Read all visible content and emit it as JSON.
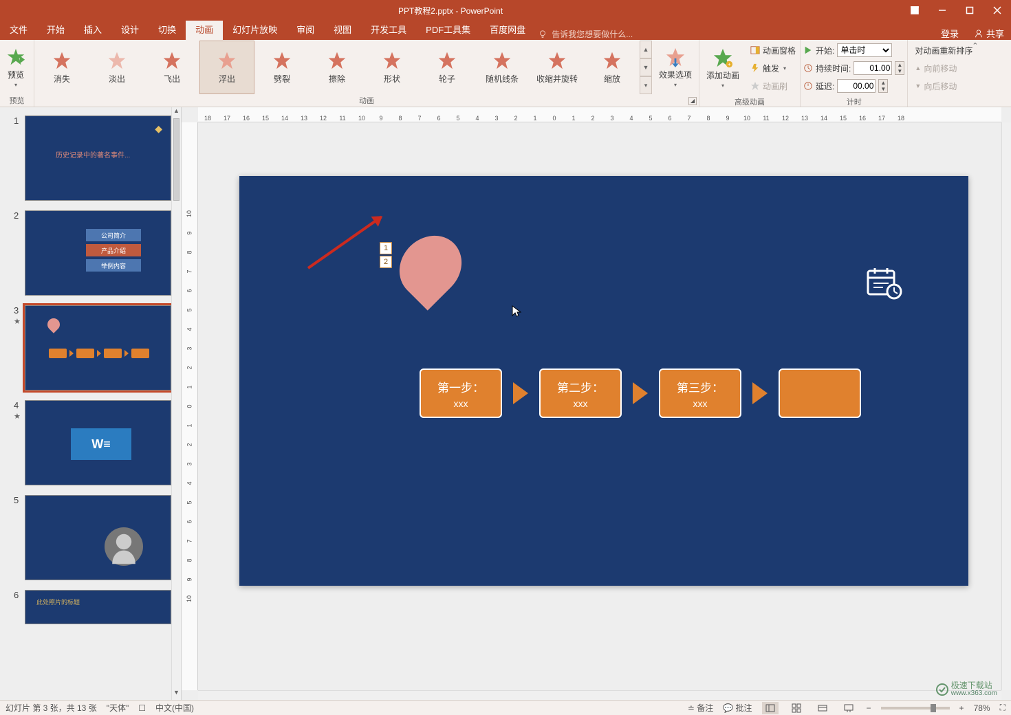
{
  "title": "PPT教程2.pptx - PowerPoint",
  "tabs": {
    "file": "文件",
    "home": "开始",
    "insert": "插入",
    "design": "设计",
    "transitions": "切换",
    "animations": "动画",
    "slideshow": "幻灯片放映",
    "review": "审阅",
    "view": "视图",
    "developer": "开发工具",
    "pdf": "PDF工具集",
    "baidu": "百度网盘",
    "tellme": "告诉我您想要做什么...",
    "signin": "登录",
    "share": "共享"
  },
  "ribbon": {
    "preview": "预览",
    "preview_group": "预览",
    "anim_group": "动画",
    "anim": {
      "disappear": "消失",
      "fade": "淡出",
      "flyout": "飞出",
      "floatout": "浮出",
      "split": "劈裂",
      "wipe": "擦除",
      "shape": "形状",
      "wheel": "轮子",
      "randombars": "随机线条",
      "shrinkturn": "收缩并旋转",
      "zoom": "缩放"
    },
    "effect_options": "效果选项",
    "adv_group": "高级动画",
    "add_anim": "添加动画",
    "anim_pane": "动画窗格",
    "trigger": "触发",
    "anim_painter": "动画刷",
    "timing_group": "计时",
    "start_label": "开始:",
    "start_value": "单击时",
    "duration_label": "持续时间:",
    "duration_value": "01.00",
    "delay_label": "延迟:",
    "delay_value": "00.00",
    "reorder_label": "对动画重新排序",
    "move_earlier": "向前移动",
    "move_later": "向后移动"
  },
  "thumbs": {
    "s1_title": "历史记录中的著名事件...",
    "s2_r1": "公司简介",
    "s2_r2": "产品介绍",
    "s2_r3": "举例内容",
    "s6_title": "此处照片的标题"
  },
  "slide": {
    "tag1": "1",
    "tag2": "2",
    "step1_t": "第一步：",
    "step1_s": "xxx",
    "step2_t": "第二步：",
    "step2_s": "xxx",
    "step3_t": "第三步：",
    "step3_s": "xxx"
  },
  "ruler_h": [
    "18",
    "17",
    "16",
    "15",
    "14",
    "13",
    "12",
    "11",
    "10",
    "9",
    "8",
    "7",
    "6",
    "5",
    "4",
    "3",
    "2",
    "1",
    "0",
    "1",
    "2",
    "3",
    "4",
    "5",
    "6",
    "7",
    "8",
    "9",
    "10",
    "11",
    "12",
    "13",
    "14",
    "15",
    "16",
    "17",
    "18"
  ],
  "ruler_v": [
    "10",
    "9",
    "8",
    "7",
    "6",
    "5",
    "4",
    "3",
    "2",
    "1",
    "0",
    "1",
    "2",
    "3",
    "4",
    "5",
    "6",
    "7",
    "8",
    "9",
    "10"
  ],
  "status": {
    "slide_info": "幻灯片 第 3 张，共 13 张",
    "font": "\"天体\"",
    "lang": "中文(中国)",
    "notes": "备注",
    "comments": "批注",
    "zoom_pct": "78%"
  },
  "watermark": {
    "brand": "极速下载站",
    "url": "www.x363.com"
  }
}
